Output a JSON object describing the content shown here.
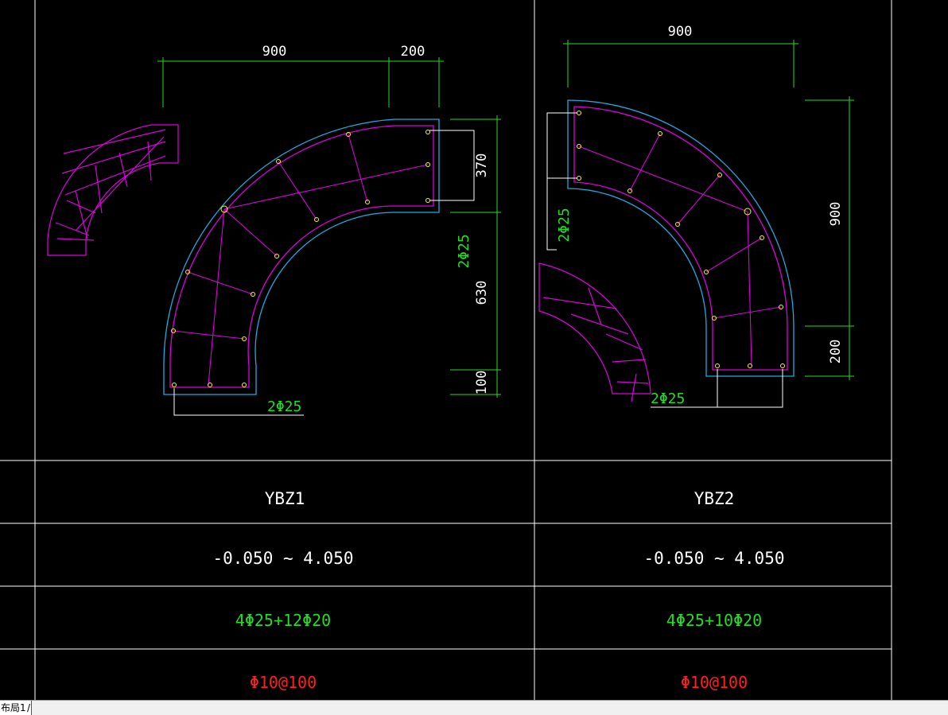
{
  "colors": {
    "background": "#000000",
    "grid": "#ffffff",
    "outline": "#1eaadf",
    "rebar": "#dd00dd",
    "dimension": "#22dd22",
    "bar_dot": "#ffff00",
    "stirrup_text": "#ff2020"
  },
  "drawing": {
    "ybz1": {
      "dim_top_1": "900",
      "dim_top_2": "200",
      "dim_right_1": "370",
      "dim_right_2": "630",
      "dim_right_3": "100",
      "callout_right": "2Φ25",
      "callout_bottom": "2Φ25"
    },
    "ybz2": {
      "dim_top": "900",
      "dim_right_1": "900",
      "dim_right_2": "200",
      "callout_left": "2Φ25",
      "callout_bottom": "2Φ25"
    }
  },
  "table": {
    "columns": [
      {
        "name": "YBZ1",
        "elevation": "-0.050 ~ 4.050",
        "longitudinal": "4Φ25+12Φ20",
        "stirrup": "Φ10@100"
      },
      {
        "name": "YBZ2",
        "elevation": "-0.050 ~ 4.050",
        "longitudinal": "4Φ25+10Φ20",
        "stirrup": "Φ10@100"
      }
    ]
  },
  "statusbar": {
    "tab_label": "布局1",
    "tab_suffix": "/"
  }
}
